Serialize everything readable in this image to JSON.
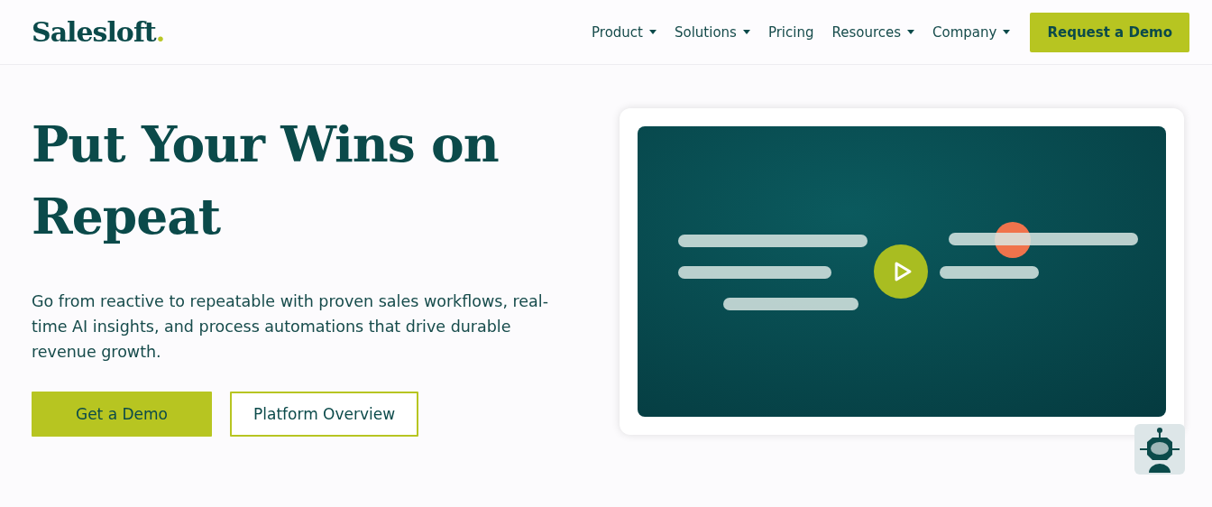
{
  "header": {
    "logo": {
      "text": "Salesloft",
      "dot": "."
    },
    "nav": [
      {
        "label": "Product",
        "dropdown": true
      },
      {
        "label": "Solutions",
        "dropdown": true
      },
      {
        "label": "Pricing",
        "dropdown": false
      },
      {
        "label": "Resources",
        "dropdown": true
      },
      {
        "label": "Company",
        "dropdown": true
      }
    ],
    "cta": "Request a Demo"
  },
  "hero": {
    "headline": "Put Your Wins on Repeat",
    "body": "Go from reactive to repeatable with proven sales workflows, real-time AI insights, and process automations that drive durable revenue growth.",
    "buttons": [
      {
        "label": "Get a Demo",
        "kind": "primary"
      },
      {
        "label": "Platform Overview",
        "kind": "outline"
      }
    ]
  }
}
